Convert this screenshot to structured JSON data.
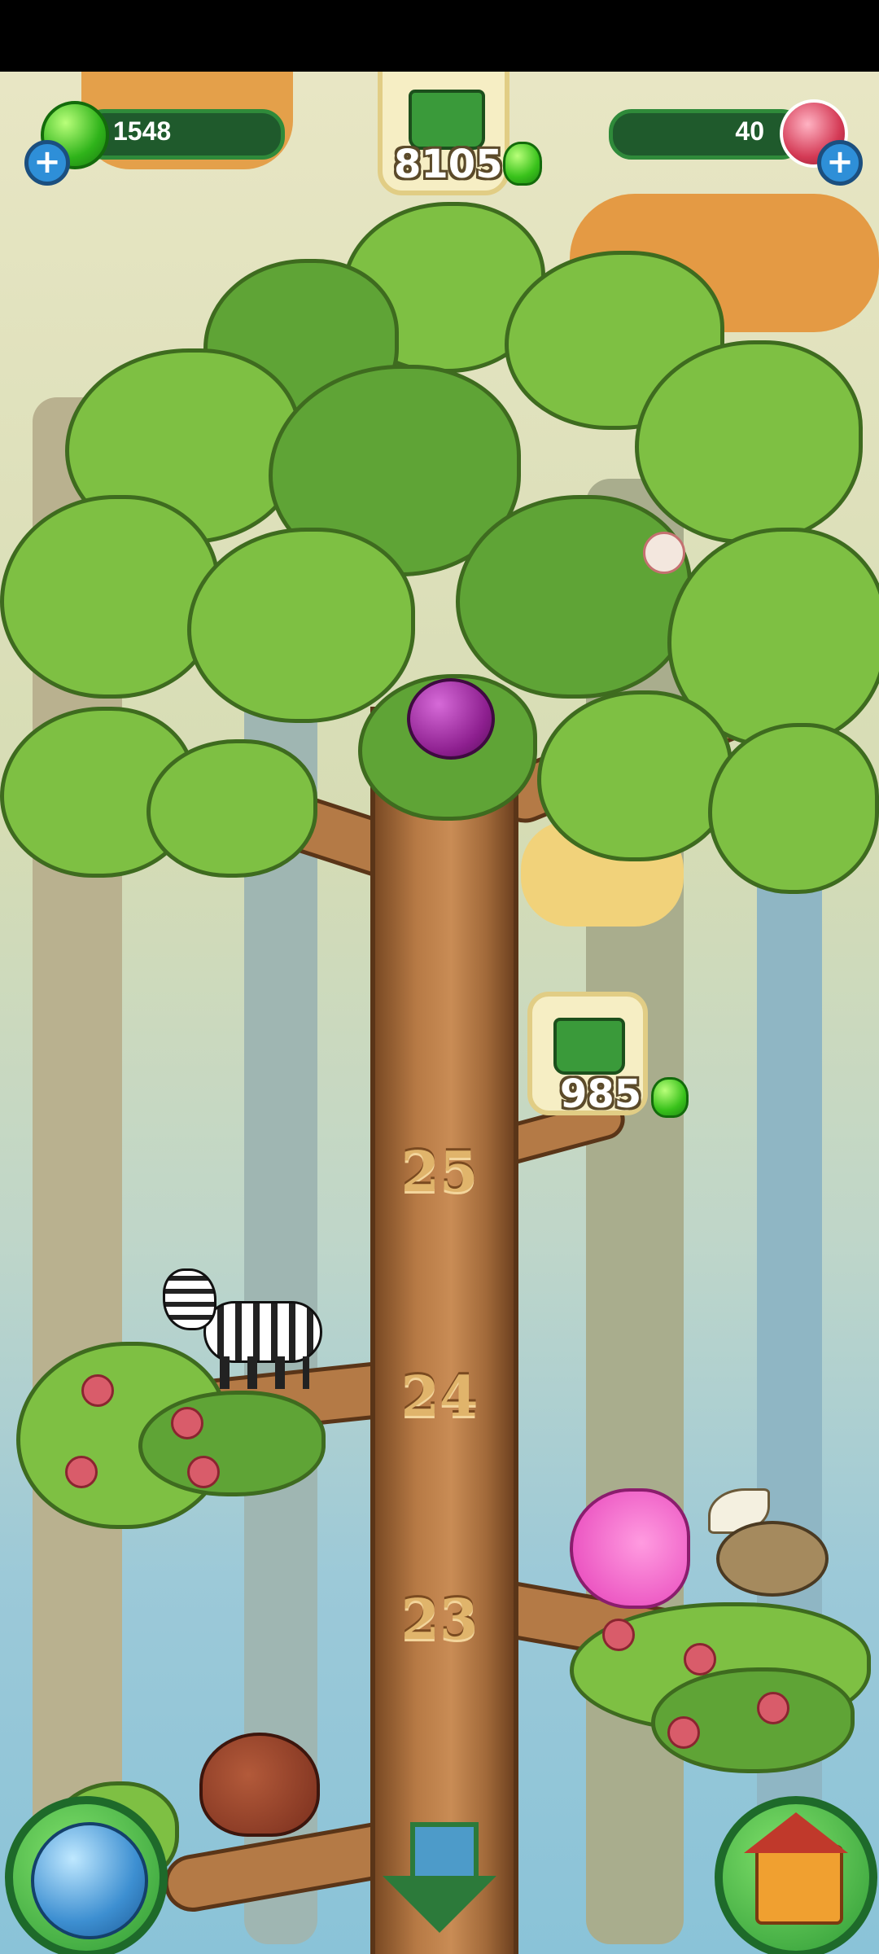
{
  "hud": {
    "gems_left": "1548",
    "gems_right": "40",
    "watering_can_top": "8105",
    "watering_can_branch": "985"
  },
  "tree": {
    "levels": [
      "25",
      "24",
      "23"
    ]
  },
  "icons": {
    "add": "+"
  },
  "colors": {
    "leaf": "#7ec043",
    "trunk": "#b77a45",
    "hud_bar": "#1f5a2c",
    "gem_green": "#39c21b",
    "crystal_red": "#d43a55"
  }
}
